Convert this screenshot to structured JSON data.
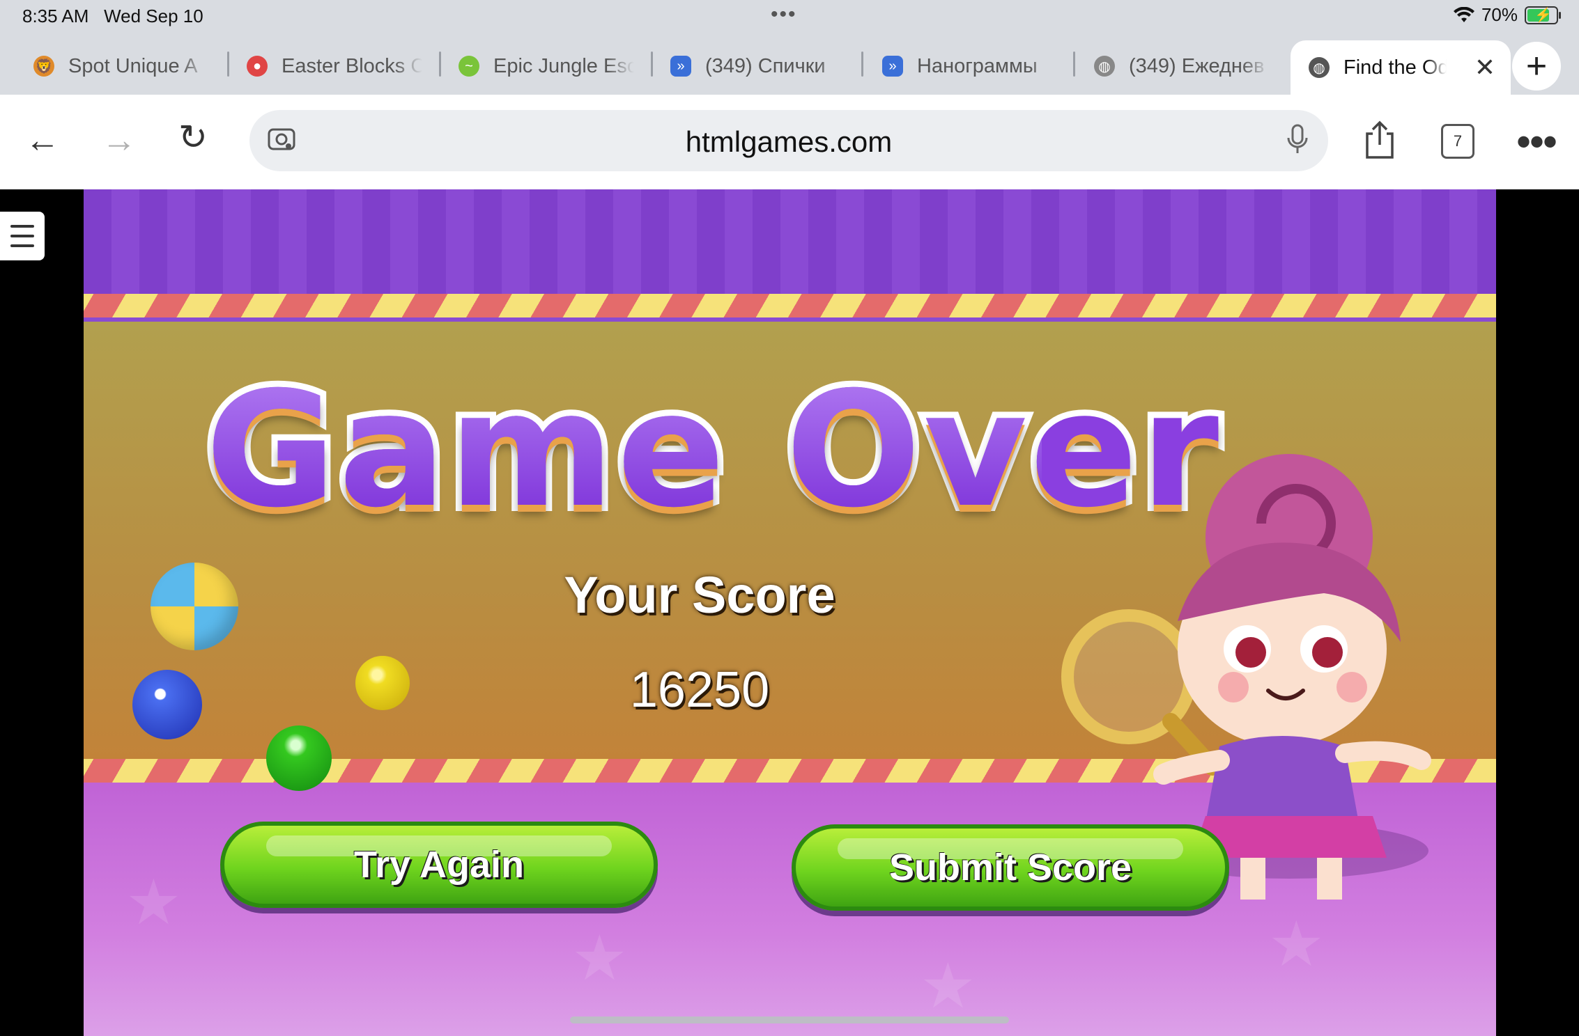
{
  "status_bar": {
    "time": "8:35 AM",
    "date": "Wed Sep 10",
    "battery": "70%"
  },
  "tabs": [
    {
      "label": "Spot Unique A",
      "icon": "lion-favicon-icon",
      "color": "#e08a2a"
    },
    {
      "label": "Easter Blocks C",
      "icon": "egg-favicon-icon",
      "color": "#e04545"
    },
    {
      "label": "Epic Jungle Esc",
      "icon": "snake-favicon-icon",
      "color": "#7ac43a"
    },
    {
      "label": "(349) Спички",
      "icon": "play-favicon-icon",
      "color": "#3a6fd8"
    },
    {
      "label": "Нанограммы",
      "icon": "play-favicon-icon",
      "color": "#3a6fd8"
    },
    {
      "label": "(349) Ежеднев",
      "icon": "globe-favicon-icon",
      "color": "#888888"
    },
    {
      "label": "Find the Od",
      "icon": "globe-favicon-icon",
      "color": "#555555"
    }
  ],
  "toolbar": {
    "url": "htmlgames.com",
    "tab_count": "7"
  },
  "game": {
    "title": "Game Over",
    "score_label": "Your Score",
    "score_value": "16250",
    "try_again_label": "Try Again",
    "submit_score_label": "Submit Score"
  },
  "colors": {
    "title_purple": "#8a3fe0",
    "button_green": "#6fd41e",
    "panel_gold": "#b88e42",
    "floor_pink": "#c063d6"
  }
}
